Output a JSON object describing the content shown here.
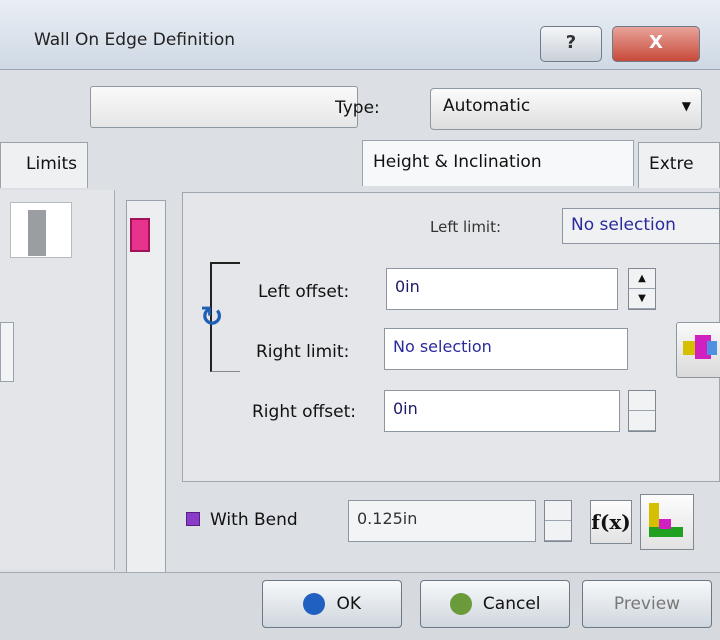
{
  "window": {
    "title": "Wall On Edge Definition",
    "help_label": "?",
    "close_label": "X"
  },
  "type_row": {
    "label": "Type:",
    "value": "Automatic"
  },
  "tabs": [
    {
      "label": "Limits"
    },
    {
      "label": "Height & Inclination"
    },
    {
      "label": "Extre"
    }
  ],
  "form": {
    "left_limit_label": "Left limit:",
    "left_limit_value": "No selection",
    "left_offset_label": "Left offset:",
    "left_offset_value": "0in",
    "right_limit_label": "Right limit:",
    "right_limit_value": "No selection",
    "right_offset_label": "Right offset:",
    "right_offset_value": "0in"
  },
  "bend": {
    "checkbox_label": "With Bend",
    "checked": true,
    "radius_value": "0.125in",
    "fx_label": "f(x)"
  },
  "buttons": {
    "ok": "OK",
    "cancel": "Cancel",
    "preview": "Preview"
  },
  "colors": {
    "accent": "#8a3cc8",
    "close": "#c74a3a",
    "link": "#1f5fb5"
  }
}
